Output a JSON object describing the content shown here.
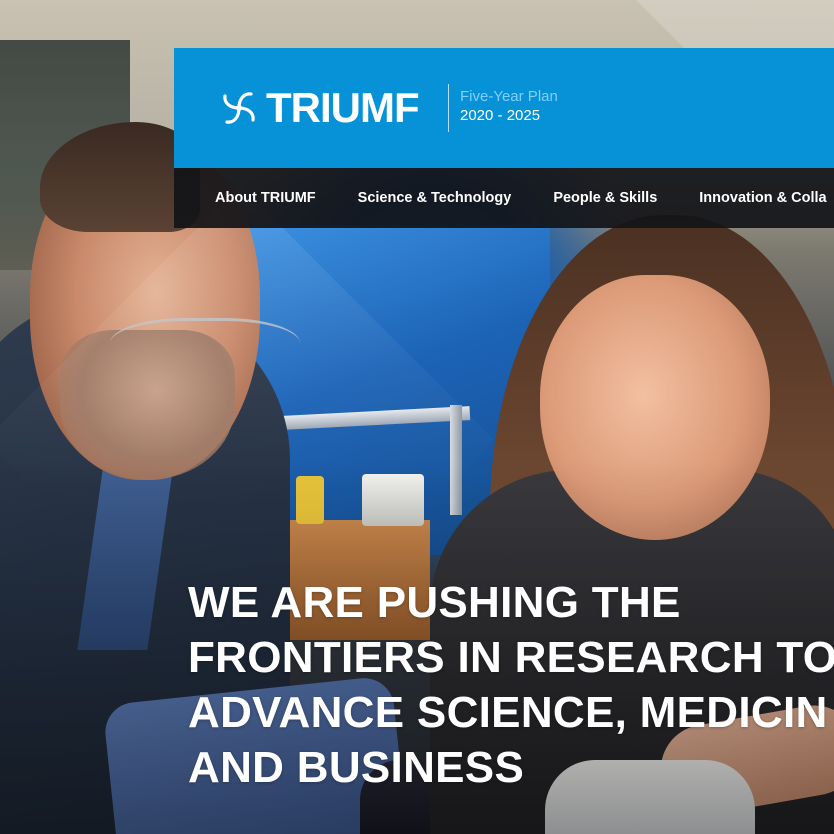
{
  "brand": {
    "logo_text": "TRIUMF",
    "plan_name": "Five-Year Plan",
    "plan_years": "2020 - 2025",
    "colors": {
      "brand_blue": "#0791d6",
      "plan_name_blue": "#7fd0ff",
      "nav_bg": "#121418"
    }
  },
  "nav": {
    "items": [
      {
        "label": "About TRIUMF"
      },
      {
        "label": "Science & Technology"
      },
      {
        "label": "People & Skills"
      },
      {
        "label": "Innovation & Colla"
      }
    ]
  },
  "hero": {
    "headline_lines": [
      "WE ARE PUSHING THE",
      "FRONTIERS IN RESEARCH TO",
      "ADVANCE SCIENCE, MEDICIN",
      "AND BUSINESS"
    ]
  },
  "icons": {
    "logo_mark": "pinwheel-logo-icon"
  }
}
